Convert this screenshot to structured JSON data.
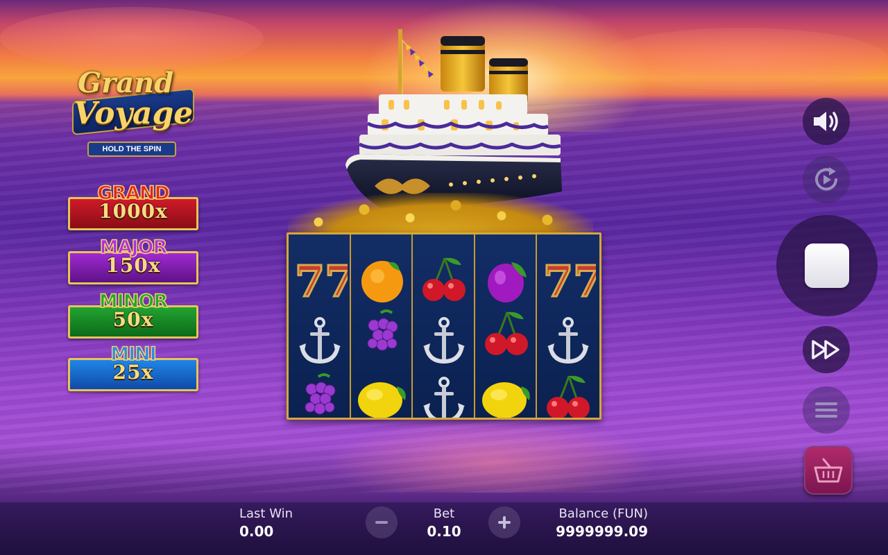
{
  "game": {
    "logo_line1": "Grand",
    "logo_line2": "Voyage",
    "logo_sub": "HOLD THE SPIN"
  },
  "jackpots": [
    {
      "name": "GRAND",
      "value": "1000x",
      "title_color": "#e02626",
      "box_color": "#b3121f"
    },
    {
      "name": "MAJOR",
      "value": "150x",
      "title_color": "#9a22c8",
      "box_color": "#7a1aa6"
    },
    {
      "name": "MINOR",
      "value": "50x",
      "title_color": "#1f9a2a",
      "box_color": "#137a22"
    },
    {
      "name": "MINI",
      "value": "25x",
      "title_color": "#1c7be0",
      "box_color": "#1456b8"
    }
  ],
  "reels": [
    [
      "seven-icon",
      "anchor-icon",
      "grapes-icon"
    ],
    [
      "orange-icon",
      "grapes-icon",
      "lemon-icon"
    ],
    [
      "cherry-icon",
      "anchor-icon",
      "anchor-icon"
    ],
    [
      "plum-icon",
      "cherry-icon",
      "lemon-icon"
    ],
    [
      "seven-icon",
      "anchor-icon",
      "cherry-icon"
    ]
  ],
  "bottom": {
    "last_win_label": "Last Win",
    "last_win_value": "0.00",
    "bet_label": "Bet",
    "bet_value": "0.10",
    "balance_label": "Balance (FUN)",
    "balance_value": "9999999.09"
  }
}
